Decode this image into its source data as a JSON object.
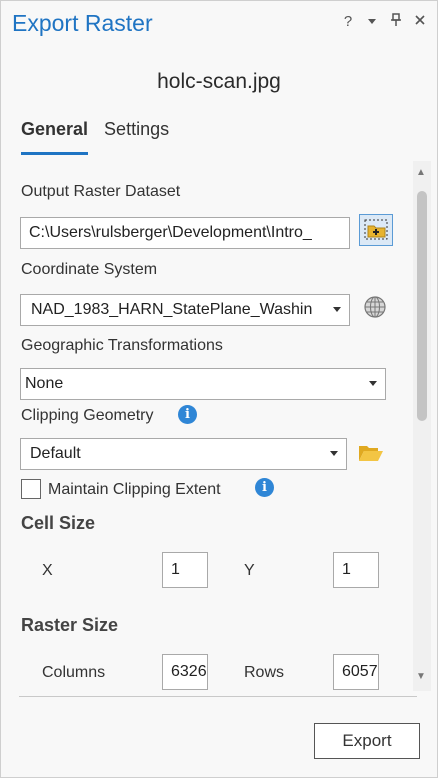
{
  "window": {
    "title": "Export Raster",
    "icons": [
      "help-icon",
      "dropdown-menu-icon",
      "pin-icon",
      "close-icon"
    ],
    "help_glyph": "?",
    "accent": "#1f74c3"
  },
  "file_name": "holc-scan.jpg",
  "tabs": [
    {
      "label": "General",
      "active": true
    },
    {
      "label": "Settings",
      "active": false
    }
  ],
  "output_raster": {
    "label": "Output Raster Dataset",
    "value": "C:\\Users\\rulsberger\\Development\\Intro_"
  },
  "coordinate_system": {
    "label": "Coordinate System",
    "value": "NAD_1983_HARN_StatePlane_Washin"
  },
  "geographic_transformations": {
    "label": "Geographic Transformations",
    "value": "None"
  },
  "clipping_geometry": {
    "label": "Clipping Geometry",
    "value": "Default"
  },
  "maintain_clipping": {
    "label": "Maintain Clipping Extent",
    "checked": false
  },
  "cell_size": {
    "label": "Cell Size",
    "x_label": "X",
    "x_value": "1",
    "y_label": "Y",
    "y_value": "1"
  },
  "raster_size": {
    "label": "Raster Size",
    "columns_label": "Columns",
    "columns_value": "6326",
    "rows_label": "Rows",
    "rows_value": "6057"
  },
  "export_button": "Export"
}
